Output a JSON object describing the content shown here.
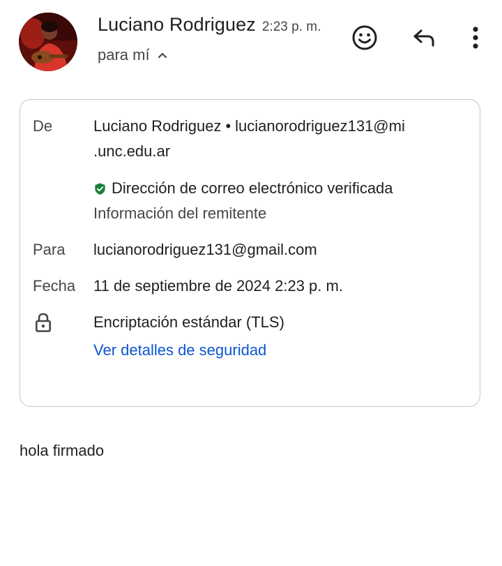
{
  "header": {
    "sender_name": "Luciano Rodriguez",
    "time": "2:23 p. m.",
    "recipient_summary": "para mí",
    "avatar_icon": "avatar-photo",
    "actions": {
      "emoji_icon": "emoji-reaction-icon",
      "reply_icon": "reply-icon",
      "more_icon": "more-vertical-icon"
    }
  },
  "details": {
    "from_label": "De",
    "from_name": "Luciano Rodriguez",
    "from_separator": "•",
    "from_email_part1": "lucianorodriguez131@mi",
    "from_email_part2": ".unc.edu.ar",
    "verified_text": "Dirección de correo electrónico verificada",
    "sender_info": "Información del remitente",
    "to_label": "Para",
    "to_value": "lucianorodriguez131@gmail.com",
    "date_label": "Fecha",
    "date_value": "11 de septiembre de 2024 2:23 p. m.",
    "encryption_value": "Encriptación estándar (TLS)",
    "security_link": "Ver detalles de seguridad"
  },
  "body": {
    "text": "hola firmado"
  },
  "colors": {
    "link": "#0b57d0",
    "verified_green": "#188038",
    "text_primary": "#1f1f1f",
    "text_secondary": "#444746",
    "border": "#c4c7c5"
  }
}
